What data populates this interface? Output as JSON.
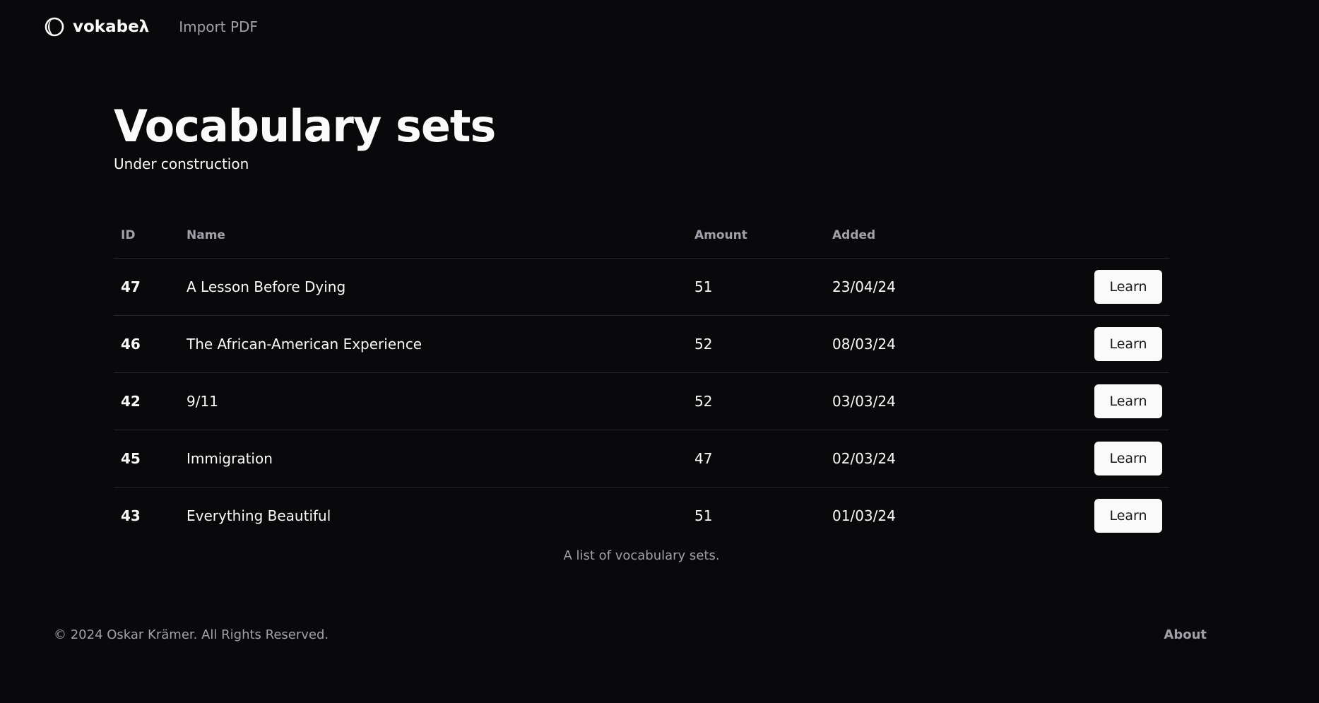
{
  "header": {
    "brand": "vokabeλ",
    "nav": [
      {
        "label": "Import PDF"
      }
    ]
  },
  "main": {
    "title": "Vocabulary sets",
    "subtitle": "Under construction",
    "table": {
      "columns": [
        "ID",
        "Name",
        "Amount",
        "Added",
        ""
      ],
      "rows": [
        {
          "id": "47",
          "name": "A Lesson Before Dying",
          "amount": "51",
          "added": "23/04/24",
          "action": "Learn"
        },
        {
          "id": "46",
          "name": "The African-American Experience",
          "amount": "52",
          "added": "08/03/24",
          "action": "Learn"
        },
        {
          "id": "42",
          "name": "9/11",
          "amount": "52",
          "added": "03/03/24",
          "action": "Learn"
        },
        {
          "id": "45",
          "name": "Immigration",
          "amount": "47",
          "added": "02/03/24",
          "action": "Learn"
        },
        {
          "id": "43",
          "name": "Everything Beautiful",
          "amount": "51",
          "added": "01/03/24",
          "action": "Learn"
        }
      ],
      "caption": "A list of vocabulary sets."
    }
  },
  "footer": {
    "copyright": "© 2024 Oskar Krämer. All Rights Reserved.",
    "about": "About"
  },
  "colors": {
    "background": "#09090b",
    "foreground": "#fafafa",
    "muted": "#a1a1aa",
    "border": "#27272a",
    "button_bg": "#fafafa",
    "button_fg": "#18181b"
  },
  "icons": {
    "logo": "circle-logo-icon"
  }
}
